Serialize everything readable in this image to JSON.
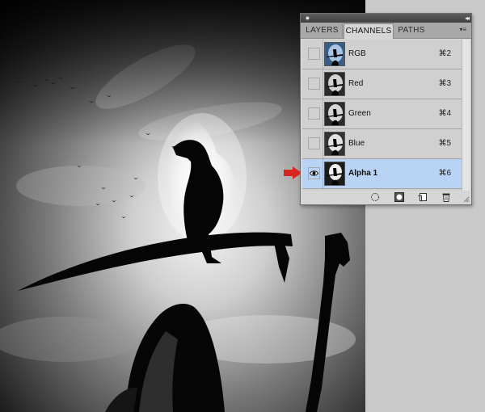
{
  "panel": {
    "close_glyph": "●",
    "collapse_glyph": "◂◂",
    "menu_glyph": "▾≡",
    "tabs": [
      {
        "label": "LAYERS",
        "active": false
      },
      {
        "label": "CHANNELS",
        "active": true
      },
      {
        "label": "PATHS",
        "active": false
      }
    ],
    "channels": [
      {
        "name": "RGB",
        "shortcut": "⌘2",
        "visible": false,
        "selected": false,
        "thumb": "color"
      },
      {
        "name": "Red",
        "shortcut": "⌘3",
        "visible": false,
        "selected": false,
        "thumb": "gray"
      },
      {
        "name": "Green",
        "shortcut": "⌘4",
        "visible": false,
        "selected": false,
        "thumb": "gray"
      },
      {
        "name": "Blue",
        "shortcut": "⌘5",
        "visible": false,
        "selected": false,
        "thumb": "gray"
      },
      {
        "name": "Alpha 1",
        "shortcut": "⌘6",
        "visible": true,
        "selected": true,
        "thumb": "alpha"
      }
    ],
    "footer_icons": [
      "load-selection-icon",
      "save-selection-icon",
      "new-channel-icon",
      "delete-channel-icon"
    ]
  },
  "colors": {
    "selected_row": "#b8d3f3",
    "arrow": "#d7261d"
  }
}
